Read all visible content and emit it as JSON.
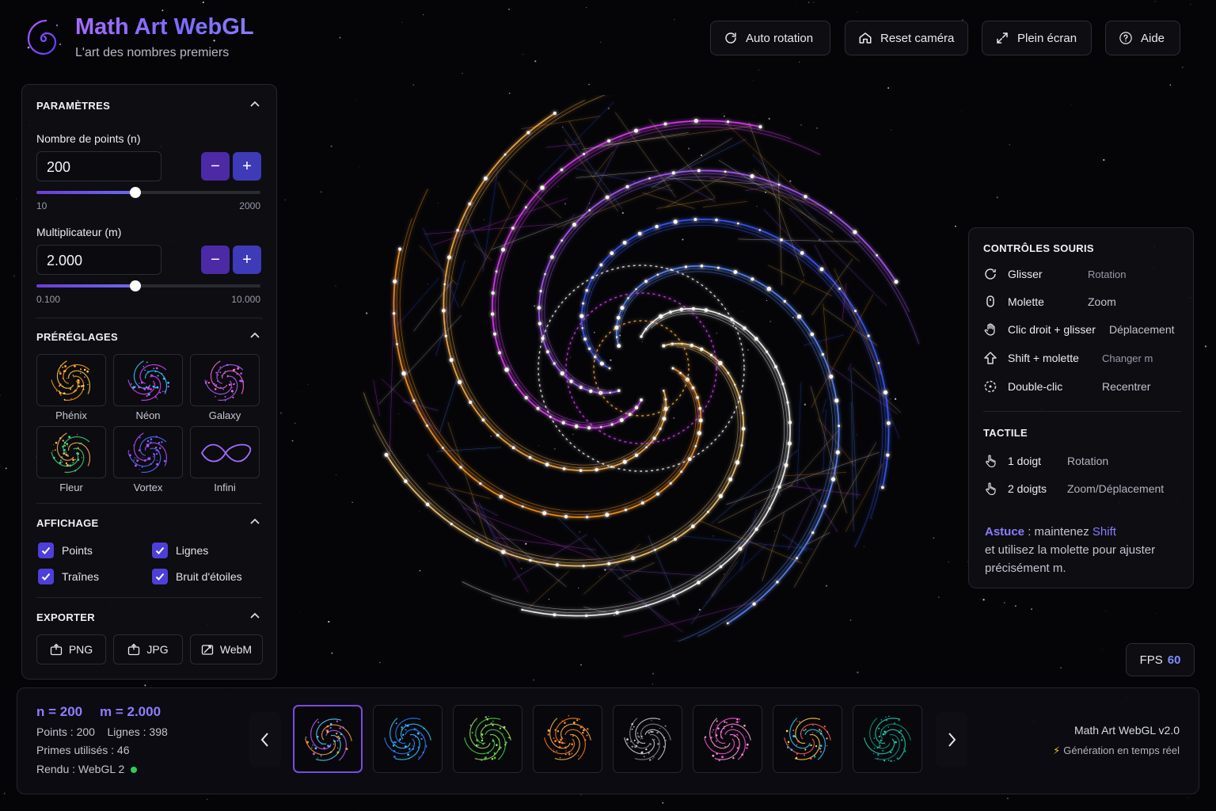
{
  "header": {
    "title": "Math Art WebGL",
    "subtitle": "L'art des nombres premiers",
    "buttons": [
      "Auto rotation",
      "Reset caméra",
      "Plein écran",
      "Aide"
    ]
  },
  "params": {
    "section": "PARAMÈTRES",
    "n_label": "Nombre de points (n)",
    "n_value": "200",
    "n_min": "10",
    "n_max": "2000",
    "n_fraction": 0.44,
    "m_label": "Multiplicateur (m)",
    "m_value": "2.000",
    "m_min": "0.100",
    "m_max": "10.000",
    "m_fraction": 0.44
  },
  "presets": {
    "section": "PRÉRÉGLAGES",
    "items": [
      {
        "label": "Phénix",
        "colors": [
          "#ff9a1f",
          "#ffcf4a"
        ]
      },
      {
        "label": "Néon",
        "colors": [
          "#e040fb",
          "#30c8ff"
        ]
      },
      {
        "label": "Galaxy",
        "colors": [
          "#b05cff",
          "#ff6ad5"
        ]
      },
      {
        "label": "Fleur",
        "colors": [
          "#3fd17a",
          "#ffb347"
        ]
      },
      {
        "label": "Vortex",
        "colors": [
          "#5b6cff",
          "#c04bff"
        ]
      },
      {
        "label": "Infini",
        "colors": [
          "#a26bff",
          "#d14bff"
        ]
      }
    ]
  },
  "display": {
    "section": "AFFICHAGE",
    "options": [
      {
        "label": "Points",
        "checked": true
      },
      {
        "label": "Lignes",
        "checked": true
      },
      {
        "label": "Traînes",
        "checked": true
      },
      {
        "label": "Bruit d'étoiles",
        "checked": true
      }
    ]
  },
  "export": {
    "section": "EXPORTER",
    "formats": [
      "PNG",
      "JPG",
      "WebM"
    ]
  },
  "mouse_controls": {
    "section": "CONTRÔLES SOURIS",
    "items": [
      {
        "key": "Glisser",
        "action": "Rotation",
        "icon": "rotate-icon"
      },
      {
        "key": "Molette",
        "action": "Zoom",
        "icon": "mouse-icon"
      },
      {
        "key": "Clic droit + glisser",
        "action": "Déplacement",
        "icon": "hand-icon"
      },
      {
        "key": "Shift + molette",
        "action": "Changer m",
        "icon": "shift-icon"
      },
      {
        "key": "Double-clic",
        "action": "Recentrer",
        "icon": "recenter-icon"
      }
    ]
  },
  "touch_controls": {
    "section": "TACTILE",
    "items": [
      {
        "key": "1 doigt",
        "action": "Rotation"
      },
      {
        "key": "2 doigts",
        "action": "Zoom/Déplacement"
      }
    ]
  },
  "tip": {
    "label": "Astuce",
    "sep": " : maintenez ",
    "key": "Shift",
    "rest": "et utilisez la molette pour ajuster précisément m."
  },
  "fps": {
    "label": "FPS",
    "value": "60"
  },
  "stats": {
    "n_text": "n = 200",
    "m_text": "m = 2.000",
    "points": "Points : 200",
    "lines": "Lignes : 398",
    "primes": "Primes utilisés : 46",
    "render": "Rendu : WebGL 2"
  },
  "gallery": [
    {
      "colors": [
        "#ff9a3c",
        "#b05cff",
        "#4dd0ff"
      ],
      "active": true
    },
    {
      "colors": [
        "#2f7bff",
        "#30c8ff"
      ],
      "active": false
    },
    {
      "colors": [
        "#3fd13f",
        "#9be15d"
      ],
      "active": false
    },
    {
      "colors": [
        "#ff7a1a",
        "#ffb347"
      ],
      "active": false
    },
    {
      "colors": [
        "#d0d0d0",
        "#888888"
      ],
      "active": false
    },
    {
      "colors": [
        "#ff4fd8",
        "#ff9ad5"
      ],
      "active": false
    },
    {
      "colors": [
        "#ff5a5a",
        "#30c8ff",
        "#ffd23f"
      ],
      "active": false
    },
    {
      "colors": [
        "#1fd1b0",
        "#0f8f80"
      ],
      "active": false
    }
  ],
  "footer": {
    "version": "Math Art WebGL v2.0",
    "realtime": "Génération en temps réel"
  },
  "colors": {
    "accent": "#7c6cff",
    "orange": "#ff9a1f",
    "magenta": "#e040fb",
    "blue": "#3b5cff",
    "white": "#ffffff"
  }
}
